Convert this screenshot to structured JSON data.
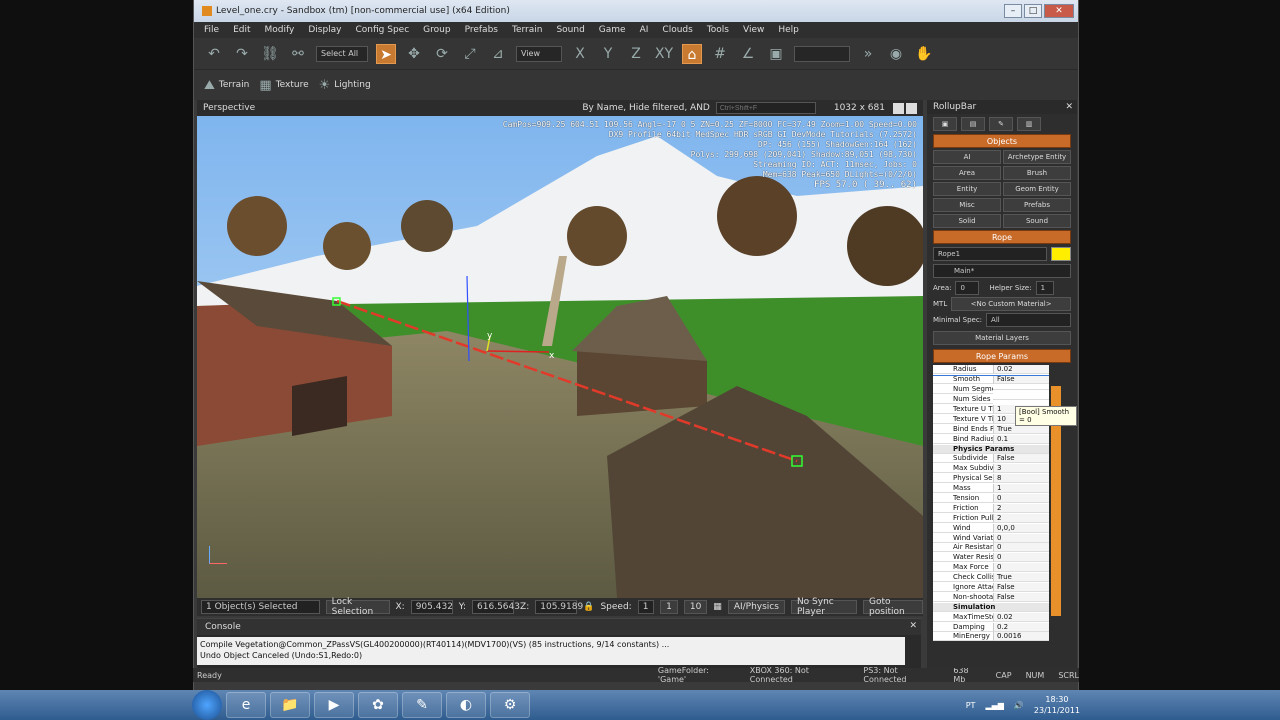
{
  "window": {
    "title": "Level_one.cry - Sandbox (tm) [non-commercial use] (x64 Edition)"
  },
  "menu": [
    "File",
    "Edit",
    "Modify",
    "Display",
    "Config Spec",
    "Group",
    "Prefabs",
    "Terrain",
    "Sound",
    "Game",
    "AI",
    "Clouds",
    "Tools",
    "View",
    "Help"
  ],
  "toolbar": {
    "select_all": "Select All",
    "view_combo": "View"
  },
  "toolbar2": {
    "terrain": "Terrain",
    "texture": "Texture",
    "lighting": "Lighting"
  },
  "viewport": {
    "label": "Perspective",
    "filter": "By Name, Hide filtered, AND",
    "search_placeholder": "Ctrl+Shift+F",
    "resolution": "1032 x 681",
    "stats": [
      "CamPos=909.25 604.51 109.56 Angl=-17  0   5 ZN=0.25 ZF=8000 FC=37.49 Zoom=1.00 Speed=0.00",
      "DX9 Profile 64bit MedSpec HDR sRGB GI DevMode Tutorials (7.2572)",
      "DP: 456 (155) ShadowGen:164 (162)",
      "Polys: 299,698 (209,041) Shadow:89,051 (98,730)",
      "Streaming IO: ACT: 11msec, Jobs: 0",
      "Mem=638 Peak=650 DLights=(0/2/0)",
      "FPS  57.0 ( 39.. 62)"
    ],
    "axis_x": "x",
    "axis_y": "y"
  },
  "status_row": {
    "selected": "1 Object(s) Selected",
    "lock_selection": "Lock Selection",
    "x_label": "X:",
    "x": "905.432",
    "y_label": "Y:",
    "y": "616.5643",
    "z_label": "Z:",
    "z": "105.9189",
    "speed_label": "Speed:",
    "speed": "1",
    "speed1": "1",
    "speed10": "10",
    "ai_physics": "AI/Physics",
    "no_sync": "No Sync Player",
    "goto": "Goto position"
  },
  "console": {
    "title": "Console",
    "lines": [
      "Compile Vegetation@Common_ZPassVS(GL400200000)(RT40114)(MDV1700)(VS) (85 instructions, 9/14 constants) ...",
      "Undo Object Canceled (Undo:S1,Redo:0)"
    ]
  },
  "app_status": {
    "ready": "Ready",
    "gamefolder": "GameFolder: 'Game'",
    "xbox": "XBOX 360: Not Connected",
    "ps3": "PS3: Not Connected",
    "mem": "638 Mb",
    "cap": "CAP",
    "num": "NUM",
    "scrl": "SCRL"
  },
  "rollup": {
    "title": "RollupBar",
    "objects_hdr": "Objects",
    "object_buttons": [
      "AI",
      "Archetype Entity",
      "Area",
      "Brush",
      "Entity",
      "Geom Entity",
      "Misc",
      "Prefabs",
      "Solid",
      "Sound"
    ],
    "rope_hdr": "Rope",
    "rope_name": "Rope1",
    "layer": "Main*",
    "area_label": "Area:",
    "area": "0",
    "helper_label": "Helper Size:",
    "helper": "1",
    "mtl_label": "MTL",
    "mtl": "<No Custom Material>",
    "minspec_label": "Minimal Spec:",
    "minspec": "All",
    "material_layers": "Material Layers",
    "rope_params": "Rope Params",
    "tooltip": "[Bool] Smooth = 0",
    "props": [
      {
        "k": "Radius",
        "v": "0.02"
      },
      {
        "k": "Smooth",
        "v": "False"
      },
      {
        "k": "Num Segments",
        "v": ""
      },
      {
        "k": "Num Sides",
        "v": ""
      },
      {
        "k": "Texture U Tiling",
        "v": "1"
      },
      {
        "k": "Texture V Tiling",
        "v": "10"
      },
      {
        "k": "Bind Ends Radius",
        "v": "True"
      },
      {
        "k": "Bind Radius",
        "v": "0.1"
      },
      {
        "k": "Physics Params",
        "v": "",
        "group": true
      },
      {
        "k": "Subdivide",
        "v": "False"
      },
      {
        "k": "Max Subdiv Verts",
        "v": "3"
      },
      {
        "k": "Physical Segments",
        "v": "8"
      },
      {
        "k": "Mass",
        "v": "1"
      },
      {
        "k": "Tension",
        "v": "0"
      },
      {
        "k": "Friction",
        "v": "2"
      },
      {
        "k": "Friction Pull",
        "v": "2"
      },
      {
        "k": "Wind",
        "v": "0,0,0"
      },
      {
        "k": "Wind Variation",
        "v": "0"
      },
      {
        "k": "Air Resistance",
        "v": "0"
      },
      {
        "k": "Water Resistance",
        "v": "0"
      },
      {
        "k": "Max Force",
        "v": "0"
      },
      {
        "k": "Check Collisions",
        "v": "True"
      },
      {
        "k": "Ignore Attachments",
        "v": "False"
      },
      {
        "k": "Non-shootable",
        "v": "False"
      },
      {
        "k": "Simulation",
        "v": "",
        "group": true
      },
      {
        "k": "MaxTimeStep",
        "v": "0.02"
      },
      {
        "k": "Damping",
        "v": "0.2"
      },
      {
        "k": "MinEnergy",
        "v": "0.0016"
      }
    ]
  },
  "taskbar": {
    "lang": "PT",
    "time": "18:30",
    "date": "23/11/2011"
  },
  "colors": {
    "accent": "#c86a28",
    "rope_color": "#ffee00"
  }
}
